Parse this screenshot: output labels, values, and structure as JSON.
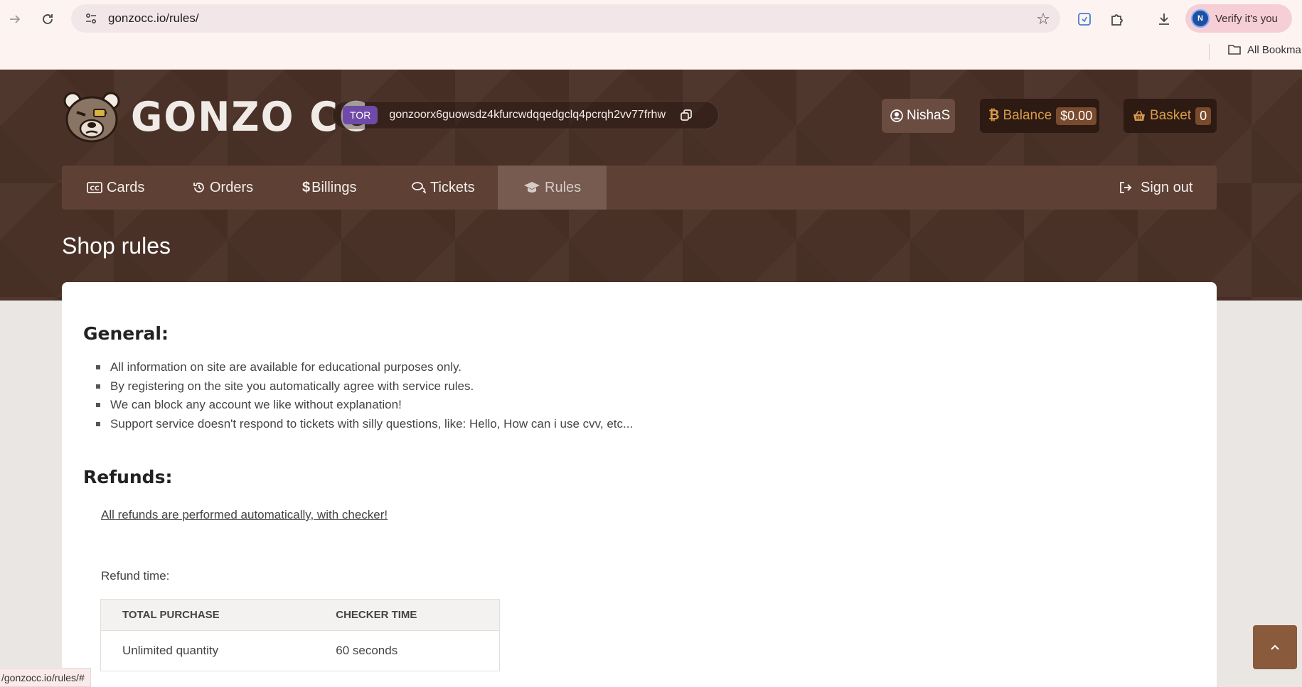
{
  "browser": {
    "url": "gonzocc.io/rules/",
    "verify_label": "Verify it's you",
    "avatar_letter": "N",
    "bookmarks_label": "All Bookma",
    "status_url": "/gonzocc.io/rules/#"
  },
  "header": {
    "logo_text": "GONZO CC",
    "tor_badge": "TOR",
    "tor_address": "gonzoorx6guowsdz4kfurcwdqqedgclq4pcrqh2vv77frhw",
    "username": "NishaS",
    "balance_label": "Balance",
    "balance_value": "$0.00",
    "basket_label": "Basket",
    "basket_count": "0"
  },
  "nav": {
    "items": [
      {
        "label": "Cards",
        "icon": "cc-card-icon"
      },
      {
        "label": "Orders",
        "icon": "history-icon"
      },
      {
        "label": "Billings",
        "icon": "dollar-icon"
      },
      {
        "label": "Tickets",
        "icon": "comments-icon"
      },
      {
        "label": "Rules",
        "icon": "graduation-cap-icon",
        "active": true
      }
    ],
    "signout_label": "Sign out"
  },
  "page": {
    "title": "Shop rules",
    "general_title": "General:",
    "general_rules": [
      "All information on site are available for educational purposes only.",
      "By registering on the site you automatically agree with service rules.",
      "We can block any account we like without explanation!",
      "Support service doesn't respond to tickets with silly questions, like: Hello, How can i use cvv, etc..."
    ],
    "refunds_title": "Refunds:",
    "refunds_link": "All refunds are performed automatically, with checker!",
    "refund_time_label": "Refund time:",
    "table": {
      "headers": [
        "TOTAL PURCHASE",
        "CHECKER TIME"
      ],
      "rows": [
        [
          "Unlimited quantity",
          "60 seconds"
        ]
      ]
    }
  },
  "colors": {
    "header_bg": "#4a3127",
    "nav_bg": "#5e4034",
    "accent": "#d89a48",
    "tor_badge": "#6f4aa8"
  }
}
